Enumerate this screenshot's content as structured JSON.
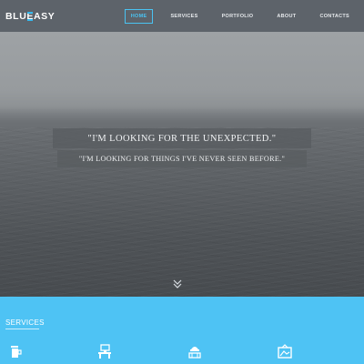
{
  "brand": {
    "part1": "BLU",
    "part2": "E",
    "part3": "ASY",
    "accent": "#35b9ef"
  },
  "nav": {
    "items": [
      {
        "label": "HOME",
        "active": true
      },
      {
        "label": "SERVICES",
        "active": false
      },
      {
        "label": "PORTFOLIO",
        "active": false
      },
      {
        "label": "ABOUT",
        "active": false
      },
      {
        "label": "CONTACTS",
        "active": false
      }
    ]
  },
  "hero": {
    "quote_primary": "\"I'M LOOKING FOR THE UNEXPECTED.\"",
    "quote_secondary": "\"I'M LOOKING FOR THINGS I'VE NEVER SEEN BEFORE.\"",
    "scroll_icon": "double-chevron-down-icon"
  },
  "services": {
    "title": "SERVICES",
    "background": "#4ec3f4",
    "icons": [
      "coffee-cup-icon",
      "computer-desk-icon",
      "construction-icon",
      "picture-frame-icon"
    ]
  }
}
